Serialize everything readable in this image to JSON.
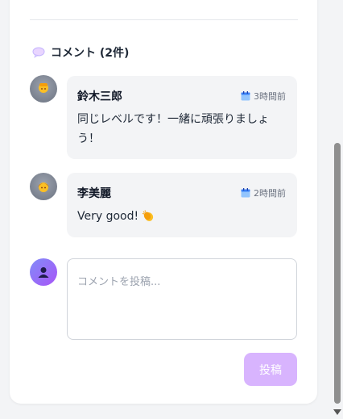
{
  "comments_section": {
    "title": "コメント (2件)",
    "icon": "speech-bubble-icon"
  },
  "comments": [
    {
      "author": "鈴木三郎",
      "time": "3時間前",
      "body": "同じレベルです！一緒に頑張りましょう！",
      "avatar_icon": "person-icon"
    },
    {
      "author": "李美麗",
      "time": "2時間前",
      "body": "Very good!",
      "body_emoji": "clapping-hands-icon",
      "avatar_icon": "person-icon"
    }
  ],
  "composer": {
    "placeholder": "コメントを投稿...",
    "submit_label": "投稿",
    "avatar_icon": "user-silhouette-icon"
  },
  "colors": {
    "accent": "#d8b4fe",
    "avatar_gradient_start": "#818cf8",
    "avatar_gradient_end": "#a855f7",
    "comment_background": "#f3f4f6"
  }
}
